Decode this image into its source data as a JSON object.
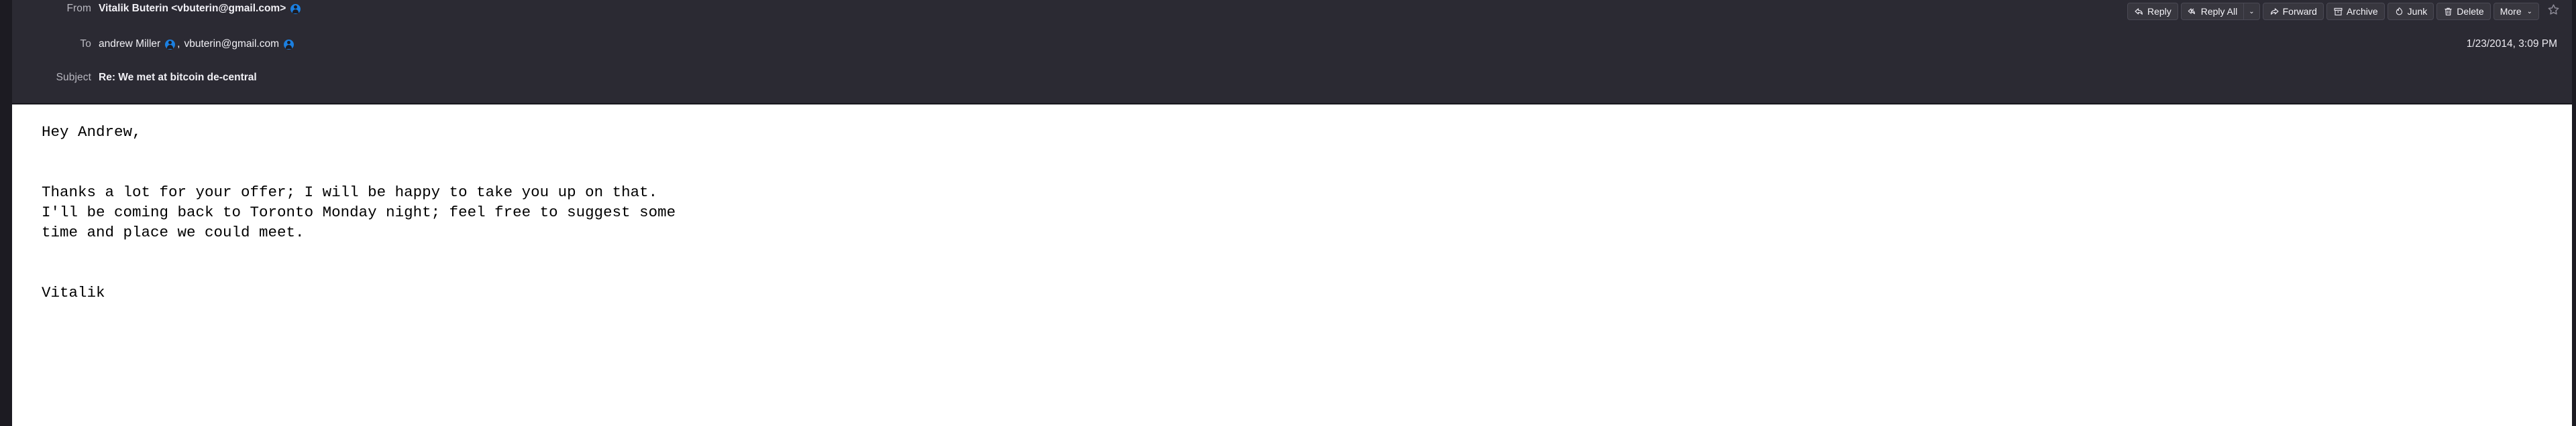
{
  "colors": {
    "header_bg": "#2b2a33",
    "gutter_bg": "#1c1b22",
    "body_bg": "#ffffff",
    "label_fg": "#b9b8c0",
    "value_fg": "#f2f1f6",
    "contact_icon": "#1b7fe0",
    "button_bg": "#38373f",
    "button_border": "#4a4954"
  },
  "header": {
    "from": {
      "label": "From",
      "value": "Vitalik Buterin <vbuterin@gmail.com>",
      "icon": "contact-icon"
    },
    "to": {
      "label": "To",
      "recipients": [
        {
          "name": "andrew Miller",
          "icon": "contact-icon"
        },
        {
          "name": "vbuterin@gmail.com",
          "icon": "contact-icon"
        }
      ],
      "separator": ","
    },
    "subject": {
      "label": "Subject",
      "value": "Re: We met at bitcoin de-central"
    },
    "date": "1/23/2014, 3:09 PM"
  },
  "toolbar": {
    "reply_label": "Reply",
    "reply_icon": "reply-arrow-icon",
    "reply_all_label": "Reply All",
    "reply_all_icon": "reply-all-arrow-icon",
    "reply_all_caret": "⌄",
    "forward_label": "Forward",
    "forward_icon": "forward-arrow-icon",
    "archive_label": "Archive",
    "archive_icon": "archive-box-icon",
    "junk_label": "Junk",
    "junk_icon": "junk-flame-icon",
    "delete_label": "Delete",
    "delete_icon": "trash-can-icon",
    "more_label": "More",
    "more_caret": "⌄",
    "star_icon": "star-outline-icon"
  },
  "message": {
    "body": "Hey Andrew,\n\n\nThanks a lot for your offer; I will be happy to take you up on that.\nI'll be coming back to Toronto Monday night; feel free to suggest some\ntime and place we could meet.\n\n\nVitalik"
  }
}
